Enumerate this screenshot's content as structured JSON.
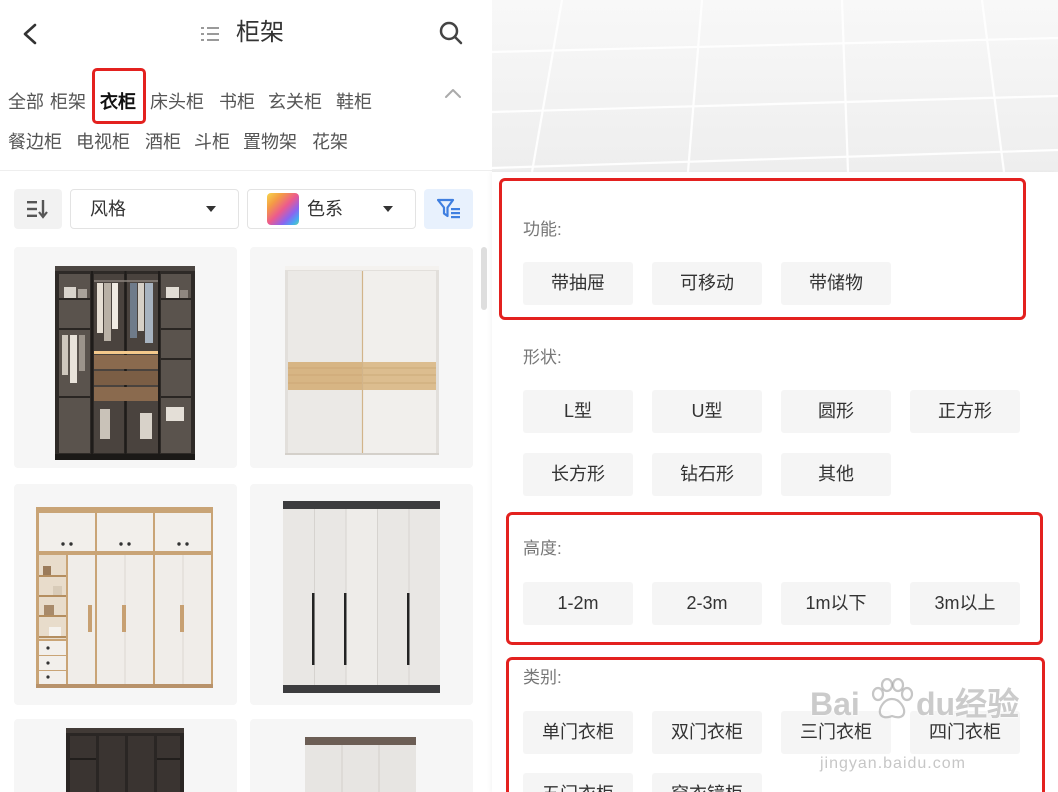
{
  "header": {
    "title": "柜架",
    "back_icon": "chevron-left-icon",
    "view_icon": "list-icon",
    "search_icon": "search-icon"
  },
  "categories": {
    "items": [
      "全部",
      "柜架",
      "衣柜",
      "床头柜",
      "书柜",
      "玄关柜",
      "鞋柜",
      "餐边柜",
      "电视柜",
      "酒柜",
      "斗柜",
      "置物架",
      "花架"
    ],
    "selected_index": 2,
    "collapse_icon": "chevron-up-icon"
  },
  "toolbar": {
    "sort_icon": "sort-icon",
    "style_dropdown": "风格",
    "color_dropdown": "色系",
    "filter_icon": "filter-icon"
  },
  "filters": [
    {
      "label": "功能:",
      "options": [
        "带抽屉",
        "可移动",
        "带储物"
      ]
    },
    {
      "label": "形状:",
      "options": [
        "L型",
        "U型",
        "圆形",
        "正方形",
        "长方形",
        "钻石形",
        "其他"
      ]
    },
    {
      "label": "高度:",
      "options": [
        "1-2m",
        "2-3m",
        "1m以下",
        "3m以上"
      ]
    },
    {
      "label": "类别:",
      "options": [
        "单门衣柜",
        "双门衣柜",
        "三门衣柜",
        "四门衣柜",
        "五门衣柜",
        "穿衣镜柜"
      ]
    }
  ],
  "colors": {
    "highlight": "#e3211f",
    "accent": "#3f7fe0",
    "chip_bg": "#f5f5f5"
  },
  "watermark": {
    "brand_prefix": "Bai",
    "brand_suffix": "du经验",
    "url": "jingyan.baidu.com",
    "logo_icon": "paw-icon"
  }
}
